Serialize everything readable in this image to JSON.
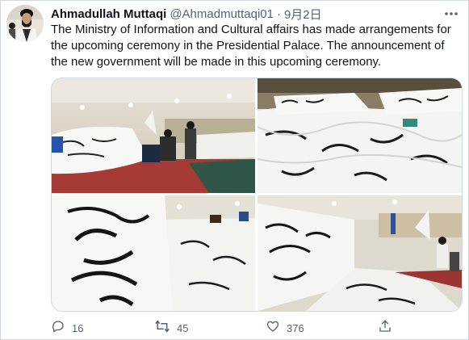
{
  "tweet": {
    "author_name": "Ahmadullah Muttaqi",
    "handle": "@Ahmadmuttaqi01",
    "separator": "·",
    "date": "9月2日",
    "text": "The Ministry of Information and Cultural affairs has made arrangements for the upcoming ceremony in the Presidential Palace. The announcement of the new government will be made in this upcoming ceremony.",
    "media_count": 4,
    "reply_count": "16",
    "retweet_count": "45",
    "like_count": "376"
  },
  "icons": {
    "more": "more-dots-icon",
    "reply": "reply-icon",
    "retweet": "retweet-icon",
    "like": "heart-icon",
    "share": "share-icon"
  },
  "colors": {
    "text": "#0f1419",
    "secondary": "#536471",
    "border": "#cfd9de"
  }
}
